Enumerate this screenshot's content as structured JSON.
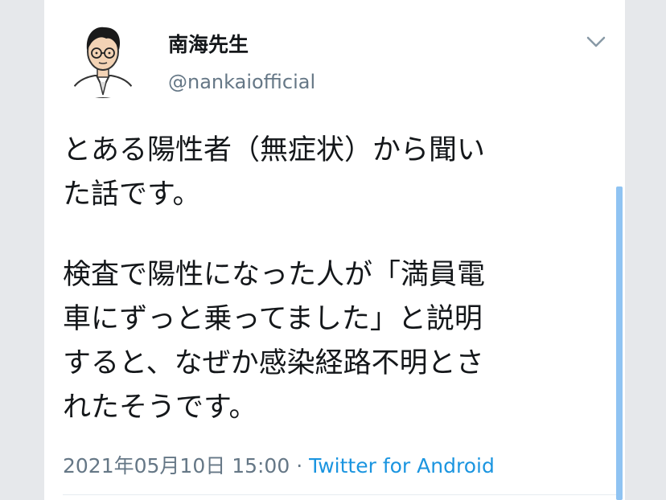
{
  "user": {
    "display_name": "南海先生",
    "handle": "@nankaiofficial",
    "avatar_icon": "illustrated-man-with-glasses-avatar"
  },
  "tweet": {
    "lines_para1": [
      "とある陽性者（無症状）から聞い",
      "た話です。"
    ],
    "lines_para2": [
      "検査で陽性になった人が「満員電",
      "車にずっと乗ってました」と説明",
      "すると、なぜか感染経路不明とさ",
      "れたそうです。"
    ]
  },
  "meta": {
    "timestamp": "2021年05月10日 15:00",
    "separator": " · ",
    "source": "Twitter for Android"
  },
  "icons": {
    "menu": "chevron-down-icon"
  },
  "colors": {
    "text": "#14171a",
    "secondary": "#657786",
    "link": "#1b95e0",
    "scroll_thumb": "#8fc3f2"
  }
}
